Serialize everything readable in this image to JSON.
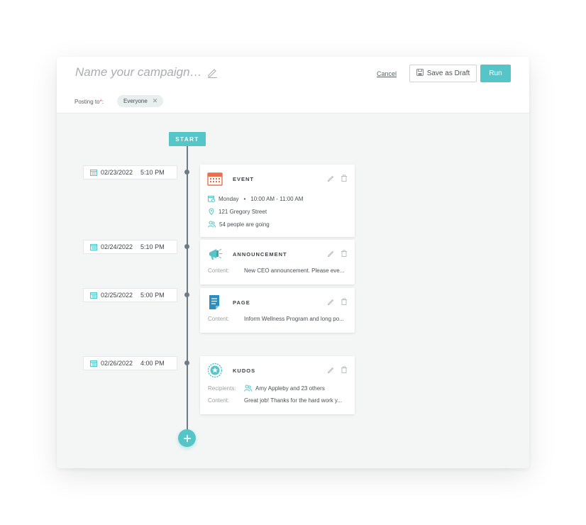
{
  "header": {
    "campaign_placeholder": "Name your campaign…",
    "cancel_label": "Cancel",
    "save_draft_label": "Save as Draft",
    "run_label": "Run",
    "posting_to_label": "Posting to",
    "posting_to_required": "*",
    "posting_to_colon": ":",
    "audience_chip": "Everyone"
  },
  "timeline": {
    "start_label": "START",
    "entries": [
      {
        "date": "02/23/2022",
        "time": "5:10 PM",
        "type": "EVENT",
        "day": "Monday",
        "bullet": "•",
        "time_range": "10:00 AM - 11:00 AM",
        "location": "121 Gregory Street",
        "attendance": "54 people are going"
      },
      {
        "date": "02/24/2022",
        "time": "5:10 PM",
        "type": "ANNOUNCEMENT",
        "content_label": "Content:",
        "content": "New CEO announcement. Please eve..."
      },
      {
        "date": "02/25/2022",
        "time": "5:00 PM",
        "type": "PAGE",
        "content_label": "Content:",
        "content": "Inform Wellness Program and long po..."
      },
      {
        "date": "02/26/2022",
        "time": "4:00 PM",
        "type": "KUDOS",
        "recipients_label": "Recipients:",
        "recipients": "Amy Appleby and 23 others",
        "content_label": "Content:",
        "content": "Great job! Thanks for the hard work y..."
      }
    ]
  },
  "colors": {
    "accent": "#56c5c8",
    "event_icon": "#e8704f",
    "page_icon": "#2a8fbf",
    "timeline": "#6e7b84"
  }
}
